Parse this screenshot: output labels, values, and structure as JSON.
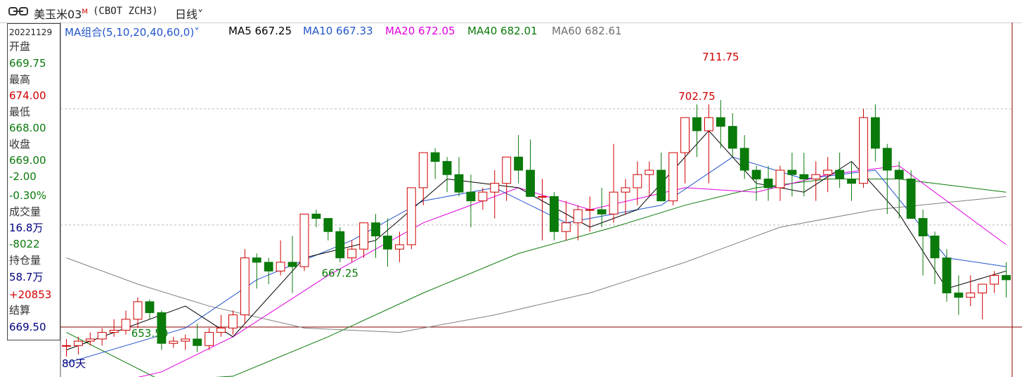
{
  "header": {
    "title": "美玉米03",
    "title_badge": "M",
    "code": "(CBOT ZCH3)",
    "period_label": "日线",
    "period_arrow": "˅"
  },
  "info_panel": {
    "date": "20221129",
    "open_label": "开盘",
    "open": "669.75",
    "high_label": "最高",
    "high": "674.00",
    "low_label": "最低",
    "low": "668.00",
    "close_label": "收盘",
    "close": "669.00",
    "change": "-2.00",
    "change_pct": "-0.30%",
    "volume_label": "成交量",
    "volume": "16.8万",
    "volume_change": "-8022",
    "oi_label": "持仓量",
    "oi": "58.7万",
    "oi_change": "+20853",
    "settle_label": "结算",
    "settle": "669.50"
  },
  "ma_bar": {
    "combo_label": "MA组合(5,10,20,40,60,0)",
    "combo_arrow": "˅",
    "ma5": "MA5 667.25",
    "ma10": "MA10 667.33",
    "ma20": "MA20 672.05",
    "ma40": "MA40 682.01",
    "ma60": "MA60 682.61"
  },
  "period_count": "80天",
  "colors": {
    "up": "#d00000",
    "down": "#0a7a0a",
    "ma5": "#000000",
    "ma10": "#2255cc",
    "ma20": "#e000e0",
    "ma40": "#0a7a0a",
    "ma60": "#808080",
    "crosshair": "#8b0000"
  },
  "chart_data": {
    "type": "candlestick",
    "y_range": [
      645,
      718
    ],
    "annotations": [
      {
        "text": "702.75",
        "value": 702.75,
        "kind": "high"
      },
      {
        "text": "711.75",
        "value": 711.75,
        "kind": "high"
      },
      {
        "text": "667.25",
        "value": 667.25,
        "kind": "low"
      },
      {
        "text": "653.50",
        "value": 653.5,
        "kind": "low"
      }
    ],
    "candles": [
      [
        648,
        649.5,
        645.5,
        648
      ],
      [
        648,
        650,
        646,
        649
      ],
      [
        649,
        651,
        648,
        649.5
      ],
      [
        649.5,
        652,
        648,
        651
      ],
      [
        651,
        654,
        650,
        651.5
      ],
      [
        651.5,
        656,
        650.5,
        654
      ],
      [
        654,
        659,
        652,
        658
      ],
      [
        658,
        658.5,
        654,
        655.5
      ],
      [
        655.5,
        656,
        647,
        648.5
      ],
      [
        648.5,
        650,
        647.5,
        649
      ],
      [
        649,
        650.5,
        647,
        649.5
      ],
      [
        649.5,
        653,
        646.5,
        648
      ],
      [
        648,
        652,
        647,
        651
      ],
      [
        651,
        655,
        650,
        652
      ],
      [
        652,
        656,
        650.5,
        655
      ],
      [
        655,
        670,
        653,
        668
      ],
      [
        668,
        669,
        661,
        667
      ],
      [
        667,
        668,
        662,
        665
      ],
      [
        665,
        672,
        664,
        667
      ],
      [
        667,
        673,
        660,
        666
      ],
      [
        666,
        678,
        665,
        678
      ],
      [
        678,
        679,
        675,
        677
      ],
      [
        677,
        677,
        672,
        674
      ],
      [
        674,
        675,
        667,
        668
      ],
      [
        668,
        672,
        667,
        670
      ],
      [
        670,
        674,
        668,
        676
      ],
      [
        676,
        678,
        668,
        673
      ],
      [
        673,
        677,
        666,
        670
      ],
      [
        670,
        674,
        667,
        671
      ],
      [
        671,
        683,
        670,
        684
      ],
      [
        684,
        690,
        680,
        692
      ],
      [
        692,
        693,
        686,
        690
      ],
      [
        690,
        691,
        683,
        687
      ],
      [
        687,
        691,
        682,
        683
      ],
      [
        683,
        687,
        675,
        681
      ],
      [
        681,
        684,
        679,
        683
      ],
      [
        683,
        688,
        677,
        685
      ],
      [
        685,
        690,
        681,
        691
      ],
      [
        691,
        696,
        685,
        688
      ],
      [
        688,
        695,
        684,
        682
      ],
      [
        682,
        686,
        672,
        682
      ],
      [
        682,
        683,
        672,
        674
      ],
      [
        674,
        681,
        672,
        676
      ],
      [
        676,
        680,
        672,
        679
      ],
      [
        679,
        682,
        674,
        679
      ],
      [
        679,
        684,
        675,
        678
      ],
      [
        678,
        694,
        676,
        683
      ],
      [
        683,
        686,
        678,
        684
      ],
      [
        684,
        690,
        680,
        687
      ],
      [
        687,
        690,
        682,
        688
      ],
      [
        688,
        692,
        683,
        681
      ],
      [
        681,
        692,
        680,
        692
      ],
      [
        692,
        698,
        685,
        700
      ],
      [
        700,
        703,
        691,
        697
      ],
      [
        697,
        703,
        685,
        700
      ],
      [
        700,
        704,
        693,
        698
      ],
      [
        698,
        701,
        691,
        693
      ],
      [
        693,
        696,
        686,
        688
      ],
      [
        688,
        689,
        681,
        686
      ],
      [
        686,
        689,
        681,
        684
      ],
      [
        684,
        689,
        681,
        688
      ],
      [
        688,
        692,
        682,
        687
      ],
      [
        687,
        692,
        682,
        686
      ],
      [
        686,
        690,
        681,
        687
      ],
      [
        687,
        691,
        683,
        688
      ],
      [
        688,
        692,
        684,
        686
      ],
      [
        686,
        690,
        681,
        685
      ],
      [
        685,
        702,
        684,
        700
      ],
      [
        700,
        703,
        690,
        693
      ],
      [
        693,
        694,
        678,
        688
      ],
      [
        688,
        690,
        677,
        686
      ],
      [
        686,
        688,
        678,
        677
      ],
      [
        677,
        679,
        664,
        673
      ],
      [
        673,
        674,
        662,
        668
      ],
      [
        668,
        670,
        658,
        660
      ],
      [
        660,
        664,
        655,
        659
      ],
      [
        659,
        664,
        657,
        660
      ],
      [
        660,
        662,
        654,
        662
      ],
      [
        662,
        665,
        660,
        664
      ],
      [
        664,
        667,
        659,
        663
      ]
    ],
    "ma": {
      "ma5": [
        [
          0,
          647
        ],
        [
          10,
          657
        ],
        [
          14,
          650
        ],
        [
          20,
          668
        ],
        [
          26,
          672
        ],
        [
          32,
          686
        ],
        [
          38,
          684
        ],
        [
          44,
          675
        ],
        [
          48,
          679
        ],
        [
          54,
          697
        ],
        [
          58,
          685
        ],
        [
          62,
          683
        ],
        [
          66,
          690
        ],
        [
          70,
          678
        ],
        [
          74,
          661
        ],
        [
          79,
          665
        ]
      ],
      "ma10": [
        [
          0,
          644
        ],
        [
          10,
          652
        ],
        [
          16,
          663
        ],
        [
          24,
          672
        ],
        [
          30,
          681
        ],
        [
          36,
          684
        ],
        [
          42,
          676
        ],
        [
          50,
          680
        ],
        [
          56,
          691
        ],
        [
          62,
          686
        ],
        [
          68,
          688
        ],
        [
          74,
          668
        ],
        [
          79,
          666
        ]
      ],
      "ma20": [
        [
          0,
          637
        ],
        [
          8,
          642
        ],
        [
          14,
          650
        ],
        [
          22,
          664
        ],
        [
          30,
          676
        ],
        [
          38,
          684
        ],
        [
          44,
          679
        ],
        [
          52,
          684
        ],
        [
          58,
          683
        ],
        [
          64,
          687
        ],
        [
          70,
          689
        ],
        [
          79,
          671
        ]
      ],
      "ma40": [
        [
          0,
          651
        ],
        [
          8,
          640
        ],
        [
          14,
          641
        ],
        [
          22,
          650
        ],
        [
          30,
          660
        ],
        [
          38,
          669
        ],
        [
          46,
          675
        ],
        [
          52,
          680
        ],
        [
          58,
          684
        ],
        [
          64,
          686
        ],
        [
          70,
          686
        ],
        [
          79,
          683
        ]
      ],
      "ma60": [
        [
          0,
          668
        ],
        [
          6,
          662
        ],
        [
          12,
          657
        ],
        [
          20,
          652
        ],
        [
          28,
          651
        ],
        [
          36,
          655
        ],
        [
          44,
          660
        ],
        [
          52,
          667
        ],
        [
          60,
          675
        ],
        [
          68,
          679
        ],
        [
          79,
          682
        ]
      ]
    }
  }
}
